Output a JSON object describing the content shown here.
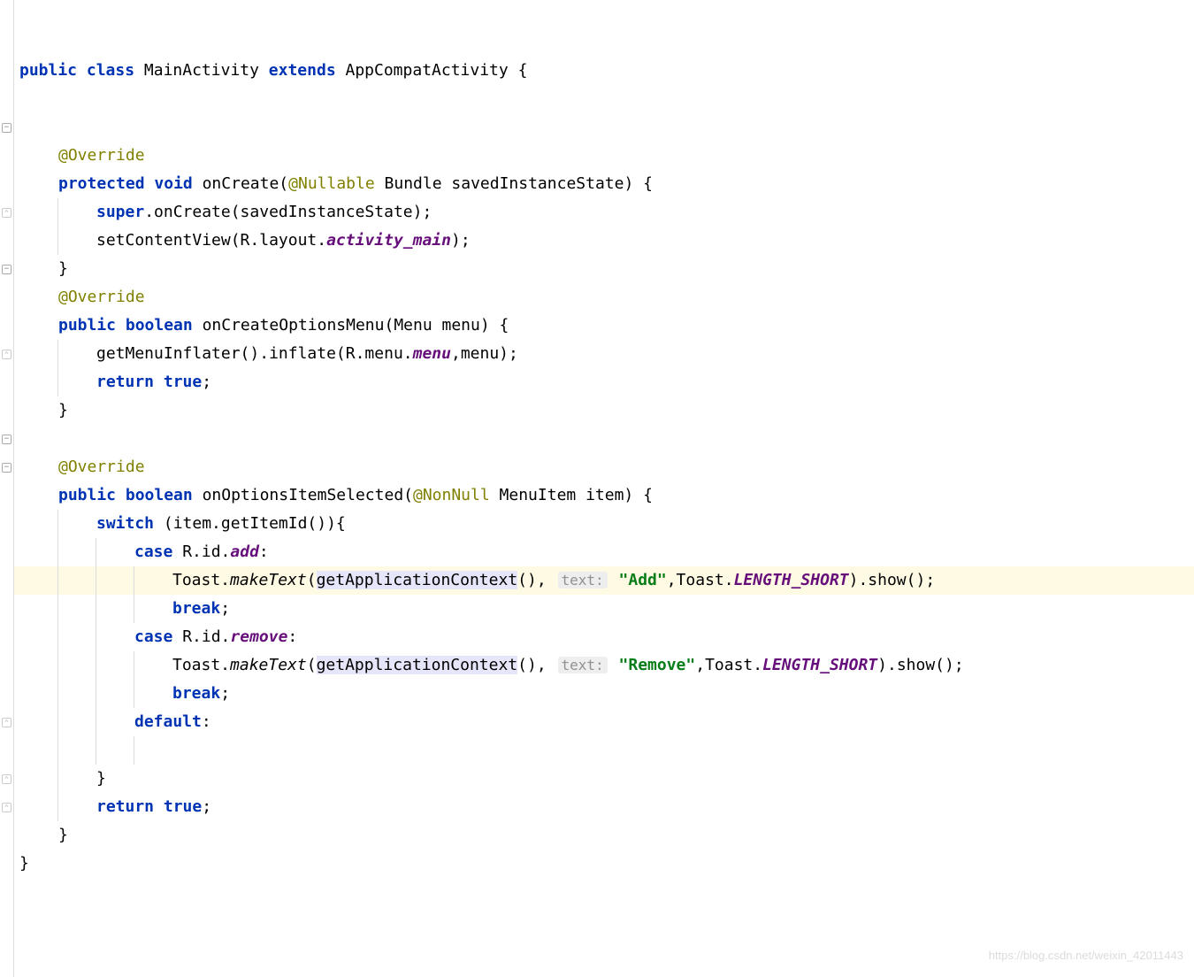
{
  "lines": {
    "l1": {
      "pre": "",
      "tokens": [
        {
          "t": "public",
          "c": "kw"
        },
        {
          "t": " "
        },
        {
          "t": "class",
          "c": "kw"
        },
        {
          "t": " "
        },
        {
          "t": "MainActivity",
          "c": "type"
        },
        {
          "t": " "
        },
        {
          "t": "extends",
          "c": "kw"
        },
        {
          "t": " "
        },
        {
          "t": "AppCompatActivity",
          "c": "type"
        },
        {
          "t": " {"
        }
      ]
    },
    "l2": {
      "pre": "    ",
      "tokens": []
    },
    "l3": {
      "pre": "    ",
      "tokens": []
    },
    "l4": {
      "pre": "    ",
      "tokens": [
        {
          "t": "@Override",
          "c": "anno"
        }
      ]
    },
    "l5": {
      "pre": "    ",
      "tokens": [
        {
          "t": "protected",
          "c": "kw"
        },
        {
          "t": " "
        },
        {
          "t": "void",
          "c": "kw"
        },
        {
          "t": " "
        },
        {
          "t": "onCreate",
          "c": "mname"
        },
        {
          "t": "("
        },
        {
          "t": "@Nullable",
          "c": "anno-param"
        },
        {
          "t": " "
        },
        {
          "t": "Bundle",
          "c": "type"
        },
        {
          "t": " savedInstanceState) {"
        }
      ]
    },
    "l6": {
      "pre": "        ",
      "tokens": [
        {
          "t": "super",
          "c": "kw"
        },
        {
          "t": ".onCreate(savedInstanceState);"
        }
      ]
    },
    "l7": {
      "pre": "        ",
      "tokens": [
        {
          "t": "setContentView(R.layout."
        },
        {
          "t": "activity_main",
          "c": "field-italic"
        },
        {
          "t": ");"
        }
      ]
    },
    "l8": {
      "pre": "    ",
      "tokens": [
        {
          "t": "}"
        }
      ]
    },
    "l9": {
      "pre": "    ",
      "tokens": [
        {
          "t": "@Override",
          "c": "anno"
        }
      ]
    },
    "l10": {
      "pre": "    ",
      "tokens": [
        {
          "t": "public",
          "c": "kw"
        },
        {
          "t": " "
        },
        {
          "t": "boolean",
          "c": "kw"
        },
        {
          "t": " "
        },
        {
          "t": "onCreateOptionsMenu",
          "c": "mname"
        },
        {
          "t": "(Menu menu) {"
        }
      ]
    },
    "l11": {
      "pre": "        ",
      "tokens": [
        {
          "t": "getMenuInflater().inflate(R.menu."
        },
        {
          "t": "menu",
          "c": "field-italic"
        },
        {
          "t": ",menu);"
        }
      ]
    },
    "l12": {
      "pre": "        ",
      "tokens": [
        {
          "t": "return",
          "c": "kw"
        },
        {
          "t": " "
        },
        {
          "t": "true",
          "c": "kw"
        },
        {
          "t": ";"
        }
      ]
    },
    "l13": {
      "pre": "    ",
      "tokens": [
        {
          "t": "}"
        }
      ]
    },
    "l14": {
      "pre": "    ",
      "tokens": []
    },
    "l15": {
      "pre": "    ",
      "tokens": [
        {
          "t": "@Override",
          "c": "anno"
        }
      ]
    },
    "l16": {
      "pre": "    ",
      "tokens": [
        {
          "t": "public",
          "c": "kw"
        },
        {
          "t": " "
        },
        {
          "t": "boolean",
          "c": "kw"
        },
        {
          "t": " "
        },
        {
          "t": "onOptionsItemSelected",
          "c": "mname"
        },
        {
          "t": "("
        },
        {
          "t": "@NonNull",
          "c": "anno-param"
        },
        {
          "t": " "
        },
        {
          "t": "MenuItem",
          "c": "type"
        },
        {
          "t": " item) {"
        }
      ]
    },
    "l17": {
      "pre": "        ",
      "tokens": [
        {
          "t": "switch",
          "c": "kw"
        },
        {
          "t": " (item.getItemId()){"
        }
      ]
    },
    "l18": {
      "pre": "            ",
      "tokens": [
        {
          "t": "case",
          "c": "kw"
        },
        {
          "t": " R.id."
        },
        {
          "t": "add",
          "c": "field-italic"
        },
        {
          "t": ":"
        }
      ]
    },
    "l19": {
      "pre": "                ",
      "hl": true,
      "tokens": [
        {
          "t": "Toast."
        },
        {
          "t": "makeText",
          "c": "static-italic"
        },
        {
          "t": "("
        },
        {
          "t": "getApplicationContext",
          "c": "",
          "bg": "hl-bg"
        },
        {
          "t": "(), "
        },
        {
          "t": "text:",
          "c": "hint"
        },
        {
          "t": " "
        },
        {
          "t": "\"Add\"",
          "c": "str"
        },
        {
          "t": ",Toast."
        },
        {
          "t": "LENGTH_SHORT",
          "c": "const-italic"
        },
        {
          "t": ").show();"
        }
      ]
    },
    "l20": {
      "pre": "                ",
      "tokens": [
        {
          "t": "break",
          "c": "kw"
        },
        {
          "t": ";"
        }
      ]
    },
    "l21": {
      "pre": "            ",
      "tokens": [
        {
          "t": "case",
          "c": "kw"
        },
        {
          "t": " R.id."
        },
        {
          "t": "remove",
          "c": "field-italic"
        },
        {
          "t": ":"
        }
      ]
    },
    "l22": {
      "pre": "                ",
      "tokens": [
        {
          "t": "Toast."
        },
        {
          "t": "makeText",
          "c": "static-italic"
        },
        {
          "t": "("
        },
        {
          "t": "getApplicationContext",
          "c": "",
          "bg": "hl-bg"
        },
        {
          "t": "(), "
        },
        {
          "t": "text:",
          "c": "hint"
        },
        {
          "t": " "
        },
        {
          "t": "\"Remove\"",
          "c": "str"
        },
        {
          "t": ",Toast."
        },
        {
          "t": "LENGTH_SHORT",
          "c": "const-italic"
        },
        {
          "t": ").show();"
        }
      ]
    },
    "l23": {
      "pre": "                ",
      "tokens": [
        {
          "t": "break",
          "c": "kw"
        },
        {
          "t": ";"
        }
      ]
    },
    "l24": {
      "pre": "            ",
      "tokens": [
        {
          "t": "default",
          "c": "kw"
        },
        {
          "t": ":"
        }
      ]
    },
    "l25": {
      "pre": "                ",
      "tokens": []
    },
    "l26": {
      "pre": "        ",
      "tokens": [
        {
          "t": "}"
        }
      ]
    },
    "l27": {
      "pre": "        ",
      "tokens": [
        {
          "t": "return",
          "c": "kw"
        },
        {
          "t": " "
        },
        {
          "t": "true",
          "c": "kw"
        },
        {
          "t": ";"
        }
      ]
    },
    "l28": {
      "pre": "    ",
      "tokens": [
        {
          "t": "}"
        }
      ]
    },
    "l29": {
      "pre": "",
      "tokens": [
        {
          "t": "}"
        }
      ]
    }
  },
  "gutter_icons": [
    {
      "line": 5,
      "type": "fold"
    },
    {
      "line": 8,
      "type": "close"
    },
    {
      "line": 10,
      "type": "fold"
    },
    {
      "line": 13,
      "type": "close"
    },
    {
      "line": 16,
      "type": "fold"
    },
    {
      "line": 17,
      "type": "fold"
    },
    {
      "line": 26,
      "type": "close"
    },
    {
      "line": 28,
      "type": "close"
    },
    {
      "line": 29,
      "type": "close"
    }
  ],
  "watermark": "https://blog.csdn.net/weixin_42011443"
}
